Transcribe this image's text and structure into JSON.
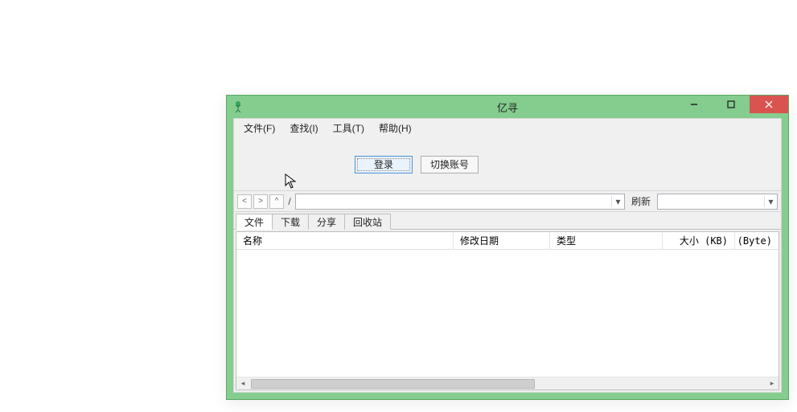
{
  "window": {
    "title": "亿寻",
    "controls": {
      "minimize": "–",
      "maximize": "▢",
      "close": "✕"
    }
  },
  "menubar": {
    "items": [
      "文件(F)",
      "查找(I)",
      "工具(T)",
      "帮助(H)"
    ]
  },
  "toolbar": {
    "login_label": "登录",
    "switch_account_label": "切换账号"
  },
  "navbar": {
    "back": "<",
    "forward": ">",
    "up": "^",
    "slash": "/",
    "path_value": "",
    "refresh_label": "刷新",
    "filter_value": ""
  },
  "tabs": {
    "items": [
      "文件",
      "下载",
      "分享",
      "回收站"
    ],
    "active_index": 0
  },
  "list": {
    "columns": [
      "名称",
      "修改日期",
      "类型",
      "大小 (KB)",
      "大小 (Byte)"
    ],
    "rows": []
  }
}
